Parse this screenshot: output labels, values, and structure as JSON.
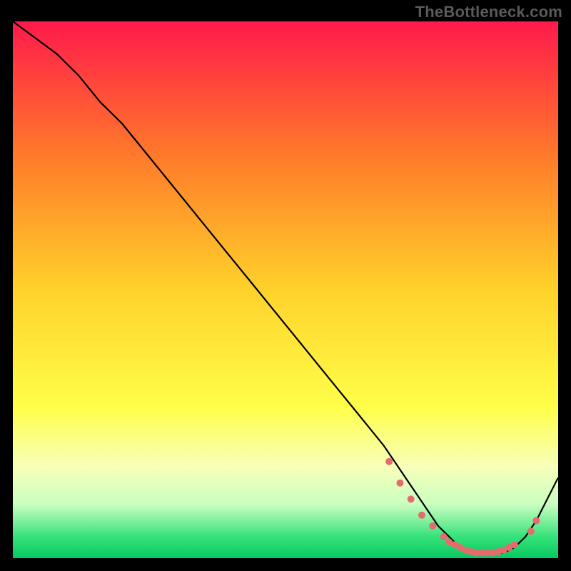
{
  "watermark": "TheBottleneck.com",
  "chart_data": {
    "type": "line",
    "title": "",
    "xlabel": "",
    "ylabel": "",
    "xlim": [
      0,
      100
    ],
    "ylim": [
      0,
      100
    ],
    "grid": false,
    "gradient_stops": [
      {
        "offset": 0,
        "color": "#ff1a4b"
      },
      {
        "offset": 25,
        "color": "#ff7a2a"
      },
      {
        "offset": 50,
        "color": "#ffd22a"
      },
      {
        "offset": 72,
        "color": "#ffff4a"
      },
      {
        "offset": 83,
        "color": "#f7ffba"
      },
      {
        "offset": 90,
        "color": "#c9ffc0"
      },
      {
        "offset": 96,
        "color": "#36e27a"
      },
      {
        "offset": 100,
        "color": "#06c95f"
      }
    ],
    "series": [
      {
        "name": "bottleneck-curve",
        "color": "#000000",
        "x": [
          0,
          4,
          8,
          12,
          16,
          20,
          24,
          28,
          32,
          36,
          40,
          44,
          48,
          52,
          56,
          60,
          64,
          68,
          70,
          72,
          74,
          76,
          78,
          80,
          82,
          84,
          86,
          88,
          90,
          92,
          94,
          96,
          98,
          100
        ],
        "y": [
          100,
          97,
          94,
          90,
          85,
          81,
          76,
          71,
          66,
          61,
          56,
          51,
          46,
          41,
          36,
          31,
          26,
          21,
          18,
          15,
          12,
          9,
          6,
          4,
          2,
          1,
          1,
          1,
          1,
          2,
          4,
          7,
          11,
          15
        ]
      }
    ],
    "markers": {
      "name": "highlight-points",
      "color": "#e76a6f",
      "radius": 5,
      "x": [
        69,
        71,
        73,
        75,
        77,
        79,
        80,
        81,
        82,
        83,
        84,
        85,
        86,
        87,
        88,
        89,
        90,
        91,
        92,
        95,
        96
      ],
      "y": [
        18,
        14,
        11,
        8,
        6,
        4,
        3,
        2.5,
        2,
        1.5,
        1.2,
        1,
        1,
        1,
        1,
        1.2,
        1.5,
        2,
        2.5,
        5,
        7
      ]
    }
  }
}
